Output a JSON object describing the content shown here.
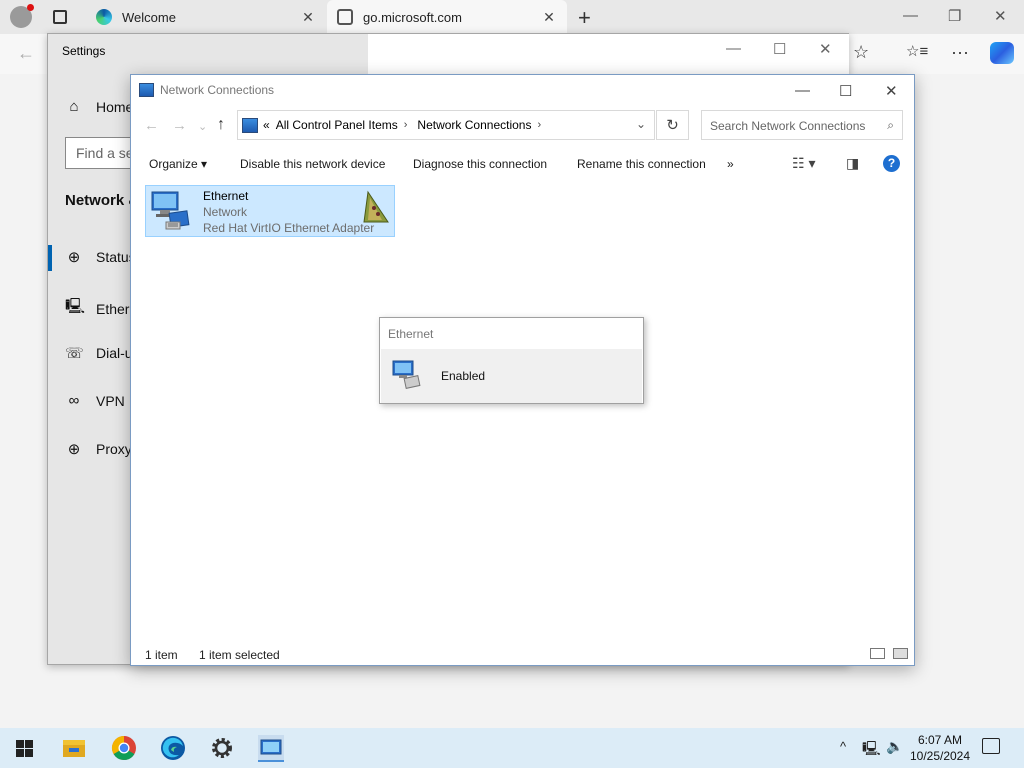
{
  "browser": {
    "tabs": [
      {
        "title": "Welcome"
      },
      {
        "title": "go.microsoft.com"
      }
    ],
    "close_glyph": "✕",
    "new_tab_glyph": "+",
    "window_controls": {
      "minimize": "—",
      "restore": "❐",
      "close": "✕"
    },
    "toolbar_icons": {
      "back": "←",
      "favorite": "☆",
      "collections": "☆≡",
      "more": "···"
    }
  },
  "settings": {
    "window_title": "Settings",
    "window_controls": {
      "minimize": "—",
      "maximize": "☐",
      "close": "✕"
    },
    "home_label": "Home",
    "search_placeholder": "Find a se",
    "section_heading": "Network &",
    "nav": [
      {
        "label": "Status",
        "icon": "globe-status-icon",
        "glyph": "⊕"
      },
      {
        "label": "Ethern",
        "icon": "ethernet-icon",
        "glyph": "🖳"
      },
      {
        "label": "Dial-u",
        "icon": "dial-up-icon",
        "glyph": "☏"
      },
      {
        "label": "VPN",
        "icon": "vpn-icon",
        "glyph": "∞"
      },
      {
        "label": "Proxy",
        "icon": "proxy-globe-icon",
        "glyph": "⊕"
      }
    ],
    "home_glyph": "⌂"
  },
  "network_connections": {
    "window_title": "Network Connections",
    "window_controls": {
      "minimize": "—",
      "maximize": "☐",
      "close": "✕"
    },
    "nav": {
      "back": "←",
      "forward": "→",
      "recent": "⌄",
      "up": "↑"
    },
    "address": {
      "prefix": "«",
      "crumbs": [
        "All Control Panel Items",
        "Network Connections"
      ],
      "separator": "›",
      "dropdown": "⌄"
    },
    "refresh_glyph": "↻",
    "search_placeholder": "Search Network Connections",
    "search_glyph": "⌕",
    "commands": {
      "organize": "Organize ▾",
      "disable": "Disable this network device",
      "diagnose": "Diagnose this connection",
      "rename": "Rename this connection",
      "more": "»",
      "view_options": "☷ ▾",
      "preview_pane": "◨",
      "help": "?"
    },
    "items": [
      {
        "name": "Ethernet",
        "status": "Network",
        "adapter": "Red Hat VirtIO Ethernet Adapter"
      }
    ],
    "status_bar": {
      "count": "1 item",
      "selected": "1 item selected"
    }
  },
  "popup": {
    "title": "Ethernet",
    "status": "Enabled"
  },
  "taskbar": {
    "apps": [
      "file-explorer-icon",
      "chrome-icon",
      "edge-icon",
      "settings-gear-icon",
      "network-connections-icon"
    ],
    "tray_chevron": "^",
    "time": "6:07 AM",
    "date": "10/25/2024"
  },
  "colors": {
    "selection_bg": "#cce8ff",
    "selection_border": "#99d1ff",
    "accent": "#0063b1",
    "taskbar": "#dcecf7"
  }
}
